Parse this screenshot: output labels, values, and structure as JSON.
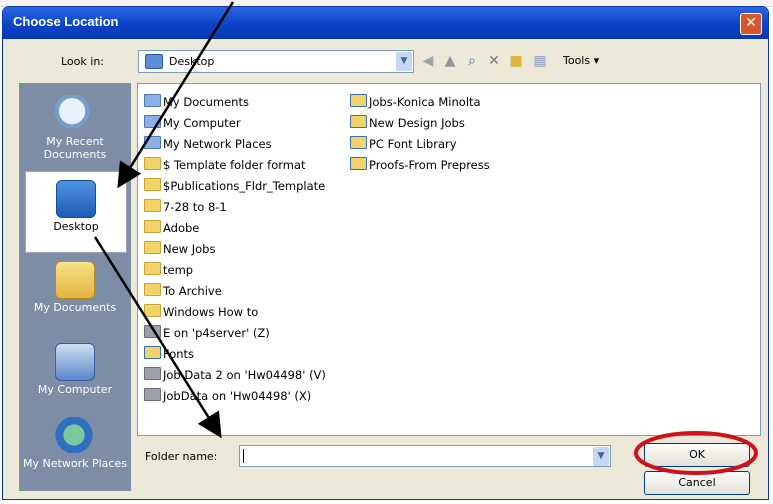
{
  "window": {
    "title": "Choose Location",
    "close_glyph": "✕"
  },
  "toolbar": {
    "look_in_label": "Look in:",
    "look_in_value": "Desktop",
    "tools_label": "Tools ▾",
    "icons": [
      "back-icon",
      "up-folder-icon",
      "search-web-icon",
      "delete-icon",
      "new-folder-icon",
      "views-icon"
    ]
  },
  "places": [
    {
      "label": "My Recent Documents",
      "icon": "recent-documents-icon"
    },
    {
      "label": "Desktop",
      "icon": "desktop-icon"
    },
    {
      "label": "My Documents",
      "icon": "my-documents-icon"
    },
    {
      "label": "My Computer",
      "icon": "my-computer-icon"
    },
    {
      "label": "My Network Places",
      "icon": "network-places-icon"
    }
  ],
  "files": {
    "col1": [
      "My Documents",
      "My Computer",
      "My Network Places",
      "$ Template folder format",
      "$Publications_Fldr_Template",
      "7-28 to 8-1",
      "Adobe",
      "New Jobs",
      "temp",
      "To Archive",
      "Windows How to",
      "E on 'p4server' (Z)",
      "Fonts",
      "Job Data 2 on 'Hw04498' (V)",
      "JobData on 'Hw04498' (X)"
    ],
    "col2": [
      "Jobs-Konica Minolta",
      "New Design Jobs",
      "PC Font Library",
      "Proofs-From Prepress"
    ]
  },
  "footer": {
    "folder_name_label": "Folder name:",
    "folder_name_value": "",
    "ok_label": "OK",
    "cancel_label": "Cancel"
  },
  "colors": {
    "titlebar": "#0a43c8",
    "annotation_arrow": "#000000",
    "ok_highlight_ring": "#d0101a"
  }
}
